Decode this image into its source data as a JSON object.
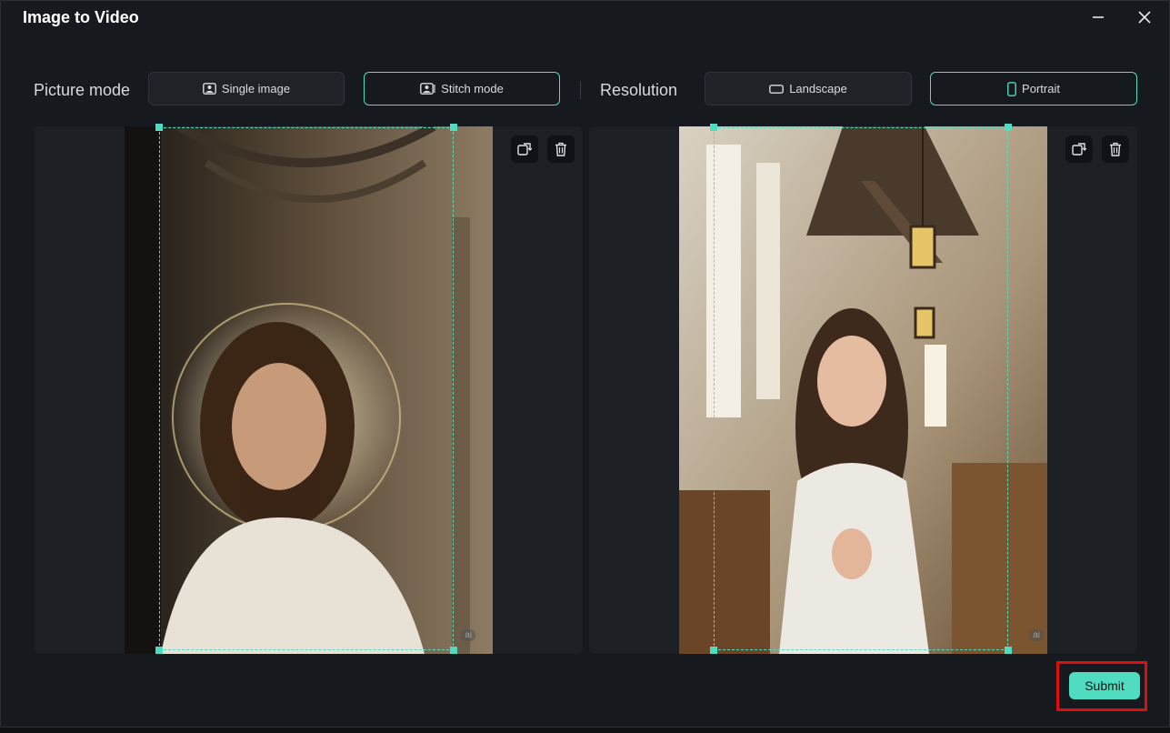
{
  "window": {
    "title": "Image to Video"
  },
  "picture_mode": {
    "label": "Picture mode",
    "options": [
      {
        "label": "Single image",
        "icon": "image-icon",
        "selected": false
      },
      {
        "label": "Stitch mode",
        "icon": "stitch-icon",
        "selected": true
      }
    ]
  },
  "resolution": {
    "label": "Resolution",
    "options": [
      {
        "label": "Landscape",
        "icon": "landscape-icon",
        "selected": false
      },
      {
        "label": "Portrait",
        "icon": "portrait-icon",
        "selected": true
      }
    ]
  },
  "images": [
    {
      "ai_badge": "ai",
      "tools": [
        "replace-icon",
        "trash-icon"
      ]
    },
    {
      "ai_badge": "ai",
      "tools": [
        "replace-icon",
        "trash-icon"
      ]
    }
  ],
  "submit_label": "Submit",
  "colors": {
    "accent": "#4fdcc0",
    "highlight": "#e00d0d",
    "background": "#16191d"
  }
}
